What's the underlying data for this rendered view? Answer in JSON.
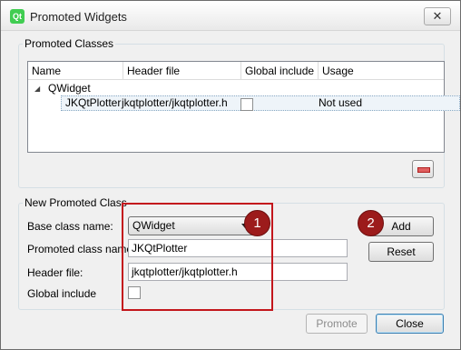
{
  "window": {
    "title": "Promoted Widgets",
    "close_symbol": "✕",
    "app_icon_text": "Qt"
  },
  "promoted_classes": {
    "group_title": "Promoted Classes",
    "columns": [
      "Name",
      "Header file",
      "Global include",
      "Usage"
    ],
    "parent": {
      "expander": "◢",
      "name": "QWidget"
    },
    "row": {
      "name": "JKQtPlotter",
      "header": "jkqtplotter/jkqtplotter.h",
      "global_include": false,
      "usage": "Not used"
    }
  },
  "new_promoted": {
    "group_title": "New Promoted Class",
    "base_label": "Base class name:",
    "base_value": "QWidget",
    "promoted_label": "Promoted class name:",
    "promoted_value": "JKQtPlotter",
    "header_label": "Header file:",
    "header_value": "jkqtplotter/jkqtplotter.h",
    "global_label": "Global include",
    "global_checked": false
  },
  "buttons": {
    "add": "Add",
    "reset": "Reset",
    "promote": "Promote",
    "close": "Close"
  },
  "annotations": {
    "badge1": "1",
    "badge2": "2"
  }
}
